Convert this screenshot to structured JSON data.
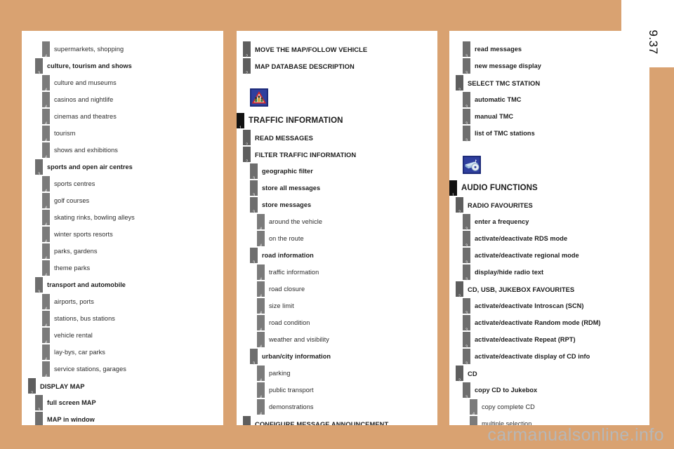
{
  "page": {
    "number": "9.37",
    "watermark": "carmanualsonline.info",
    "accent_color": "#d9a271",
    "paper_color": "#ffffff"
  },
  "columns": [
    {
      "name": "column-1",
      "blocks": [
        {
          "type": "entries",
          "entries": [
            {
              "level": 4,
              "label": "supermarkets, shopping"
            },
            {
              "level": 3,
              "label": "culture, tourism and shows"
            },
            {
              "level": 4,
              "label": "culture and museums"
            },
            {
              "level": 4,
              "label": "casinos and nightlife"
            },
            {
              "level": 4,
              "label": "cinemas and theatres"
            },
            {
              "level": 4,
              "label": "tourism"
            },
            {
              "level": 4,
              "label": "shows and exhibitions"
            },
            {
              "level": 3,
              "label": "sports and open air centres"
            },
            {
              "level": 4,
              "label": "sports centres"
            },
            {
              "level": 4,
              "label": "golf courses"
            },
            {
              "level": 4,
              "label": "skating rinks, bowling alleys"
            },
            {
              "level": 4,
              "label": "winter sports resorts"
            },
            {
              "level": 4,
              "label": "parks, gardens"
            },
            {
              "level": 4,
              "label": "theme parks"
            },
            {
              "level": 3,
              "label": "transport and automobile"
            },
            {
              "level": 4,
              "label": "airports, ports"
            },
            {
              "level": 4,
              "label": "stations, bus stations"
            },
            {
              "level": 4,
              "label": "vehicle rental"
            },
            {
              "level": 4,
              "label": "lay-bys, car parks"
            },
            {
              "level": 4,
              "label": "service stations, garages"
            },
            {
              "level": 2,
              "label": "DISPLAY MAP"
            },
            {
              "level": 3,
              "label": "full screen MAP"
            },
            {
              "level": 3,
              "label": "MAP in window"
            }
          ]
        }
      ]
    },
    {
      "name": "column-2",
      "blocks": [
        {
          "type": "entries",
          "entries": [
            {
              "level": 2,
              "label": "MOVE THE MAP/FOLLOW VEHICLE"
            },
            {
              "level": 2,
              "label": "MAP DATABASE DESCRIPTION"
            }
          ]
        },
        {
          "type": "section",
          "icon": "traffic-warning-icon",
          "icon_colors": {
            "background": "#2f3f9e",
            "sign": "#d42a2a",
            "inner": "#f2f2f2"
          },
          "heading": {
            "level": 1,
            "label": "TRAFFIC INFORMATION"
          },
          "entries": [
            {
              "level": 2,
              "label": "READ MESSAGES"
            },
            {
              "level": 2,
              "label": "FILTER TRAFFIC INFORMATION"
            },
            {
              "level": 3,
              "label": "geographic filter"
            },
            {
              "level": 3,
              "label": "store all messages"
            },
            {
              "level": 3,
              "label": "store messages"
            },
            {
              "level": 4,
              "label": "around the vehicle"
            },
            {
              "level": 4,
              "label": "on the route"
            },
            {
              "level": 3,
              "label": "road information"
            },
            {
              "level": 4,
              "label": "traffic information"
            },
            {
              "level": 4,
              "label": "road closure"
            },
            {
              "level": 4,
              "label": "size limit"
            },
            {
              "level": 4,
              "label": "road condition"
            },
            {
              "level": 4,
              "label": "weather and visibility"
            },
            {
              "level": 3,
              "label": "urban/city information"
            },
            {
              "level": 4,
              "label": "parking"
            },
            {
              "level": 4,
              "label": "public transport"
            },
            {
              "level": 4,
              "label": "demonstrations"
            },
            {
              "level": 2,
              "label": "CONFIGURE MESSAGE ANNOUNCEMENT"
            }
          ]
        }
      ]
    },
    {
      "name": "column-3",
      "blocks": [
        {
          "type": "entries",
          "entries": [
            {
              "level": 3,
              "label": "read messages"
            },
            {
              "level": 3,
              "label": "new message display"
            },
            {
              "level": 2,
              "label": "SELECT TMC STATION"
            },
            {
              "level": 3,
              "label": "automatic TMC"
            },
            {
              "level": 3,
              "label": "manual TMC"
            },
            {
              "level": 3,
              "label": "list of TMC stations"
            }
          ]
        },
        {
          "type": "section",
          "icon": "audio-cd-player-icon",
          "icon_colors": {
            "background": "#2f3f9e",
            "body": "#cfe2f2",
            "disc": "#e8eef5"
          },
          "heading": {
            "level": 1,
            "label": "AUDIO FUNCTIONS"
          },
          "entries": [
            {
              "level": 2,
              "label": "RADIO FAVOURITES"
            },
            {
              "level": 3,
              "label": "enter a frequency"
            },
            {
              "level": 3,
              "label": "activate/deactivate RDS mode"
            },
            {
              "level": 3,
              "label": "activate/deactivate regional mode"
            },
            {
              "level": 3,
              "label": "display/hide radio text"
            },
            {
              "level": 2,
              "label": "CD, USB, JUKEBOX FAVOURITES"
            },
            {
              "level": 3,
              "label": "activate/deactivate Introscan (SCN)"
            },
            {
              "level": 3,
              "label": "activate/deactivate Random mode (RDM)"
            },
            {
              "level": 3,
              "label": "activate/deactivate Repeat (RPT)"
            },
            {
              "level": 3,
              "label": "activate/deactivate display of CD info"
            },
            {
              "level": 2,
              "label": "CD"
            },
            {
              "level": 3,
              "label": "copy CD to Jukebox"
            },
            {
              "level": 4,
              "label": "copy complete CD"
            },
            {
              "level": 4,
              "label": "multiple selection"
            }
          ]
        }
      ]
    }
  ]
}
